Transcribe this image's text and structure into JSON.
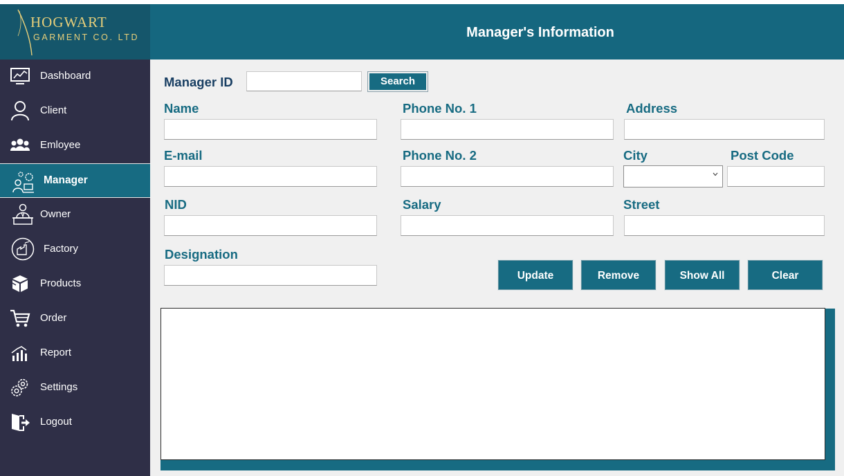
{
  "brand": {
    "line1": "HOGWART",
    "line2": "GARMENT CO. LTD",
    "gold": "#e7cf7a"
  },
  "header": {
    "title": "Manager's Information"
  },
  "sidebar": {
    "items": [
      {
        "label": "Dashboard",
        "icon": "dashboard-icon"
      },
      {
        "label": "Client",
        "icon": "user-icon"
      },
      {
        "label": "Emloyee",
        "icon": "group-icon"
      },
      {
        "label": "Manager",
        "icon": "manager-gears-icon",
        "active": true
      },
      {
        "label": "Owner",
        "icon": "owner-desk-icon"
      },
      {
        "label": "Factory",
        "icon": "factory-icon"
      },
      {
        "label": "Products",
        "icon": "boxes-icon"
      },
      {
        "label": "Order",
        "icon": "cart-icon"
      },
      {
        "label": "Report",
        "icon": "bar-chart-icon"
      },
      {
        "label": "Settings",
        "icon": "gear-icon"
      },
      {
        "label": "Logout",
        "icon": "logout-icon"
      }
    ]
  },
  "form": {
    "manager_id": {
      "label": "Manager ID",
      "value": ""
    },
    "search_label": "Search",
    "name": {
      "label": "Name",
      "value": ""
    },
    "phone1": {
      "label": "Phone No. 1",
      "value": ""
    },
    "address": {
      "label": "Address",
      "value": ""
    },
    "email": {
      "label": "E-mail",
      "value": ""
    },
    "phone2": {
      "label": "Phone No. 2",
      "value": ""
    },
    "city": {
      "label": "City",
      "value": ""
    },
    "post_code": {
      "label": "Post Code",
      "value": ""
    },
    "nid": {
      "label": "NID",
      "value": ""
    },
    "salary": {
      "label": "Salary",
      "value": ""
    },
    "street": {
      "label": "Street",
      "value": ""
    },
    "designation": {
      "label": "Designation",
      "value": ""
    }
  },
  "actions": {
    "update": "Update",
    "remove": "Remove",
    "show_all": "Show All",
    "clear": "Clear"
  },
  "colors": {
    "accent": "#176b82",
    "sidebar": "#2f2f47",
    "header": "#15677f"
  }
}
